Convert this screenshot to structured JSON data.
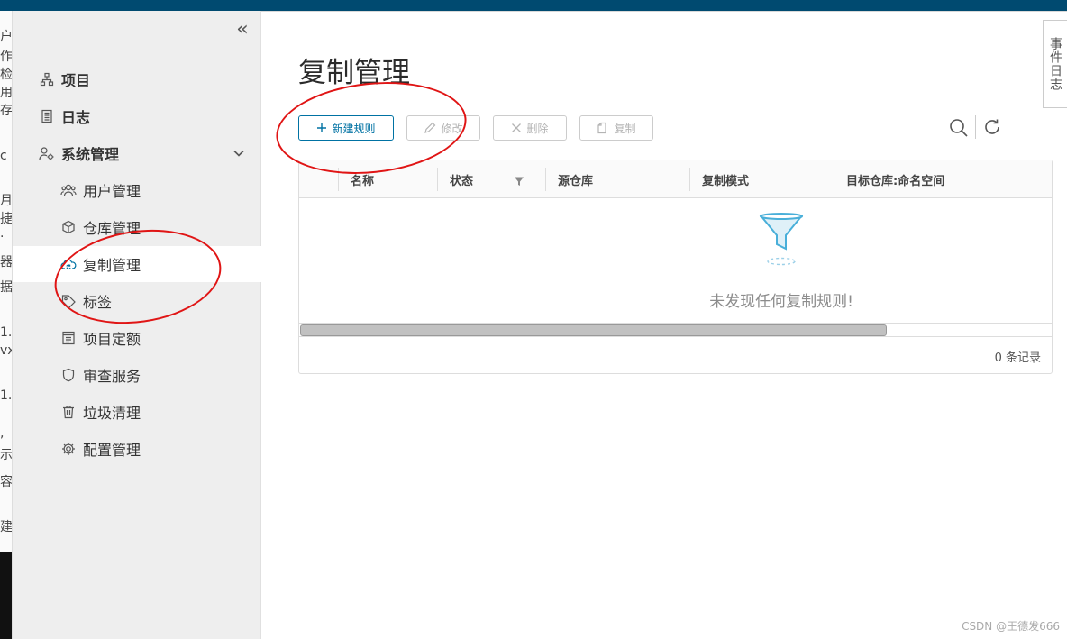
{
  "left_strip": {
    "chars": [
      "户",
      "作",
      "检",
      "用",
      "存",
      "c",
      "月",
      "捷",
      "·",
      "器",
      "据",
      "1.",
      "vx",
      "1.",
      ",",
      "示",
      "容",
      "建"
    ]
  },
  "sidebar": {
    "collapse_glyph": "«",
    "items": [
      {
        "label": "项目",
        "level": 1,
        "icon": "project-icon"
      },
      {
        "label": "日志",
        "level": 1,
        "icon": "log-icon"
      },
      {
        "label": "系统管理",
        "level": 1,
        "icon": "system-admin-icon",
        "expanded": true
      },
      {
        "label": "用户管理",
        "level": 2,
        "icon": "users-icon"
      },
      {
        "label": "仓库管理",
        "level": 2,
        "icon": "box-icon"
      },
      {
        "label": "复制管理",
        "level": 2,
        "icon": "cloud-sync-icon",
        "active": true
      },
      {
        "label": "标签",
        "level": 2,
        "icon": "tag-icon"
      },
      {
        "label": "项目定额",
        "level": 2,
        "icon": "quota-icon"
      },
      {
        "label": "审查服务",
        "level": 2,
        "icon": "shield-icon"
      },
      {
        "label": "垃圾清理",
        "level": 2,
        "icon": "trash-icon"
      },
      {
        "label": "配置管理",
        "level": 2,
        "icon": "gear-icon"
      }
    ]
  },
  "main": {
    "title": "复制管理",
    "toolbar": {
      "new_rule": "新建规则",
      "edit": "修改",
      "delete": "删除",
      "copy": "复制"
    },
    "grid": {
      "columns": [
        "名称",
        "状态",
        "源仓库",
        "复制模式",
        "目标仓库:命名空间"
      ],
      "empty_message": "未发现任何复制规则!",
      "footer": "0 条记录",
      "scroll_fraction": 0.78
    }
  },
  "event_log": "事件日志",
  "watermark": "CSDN @王德发666",
  "colors": {
    "topbar": "#004a70",
    "primary": "#0072a3",
    "annotation": "#e01515"
  }
}
